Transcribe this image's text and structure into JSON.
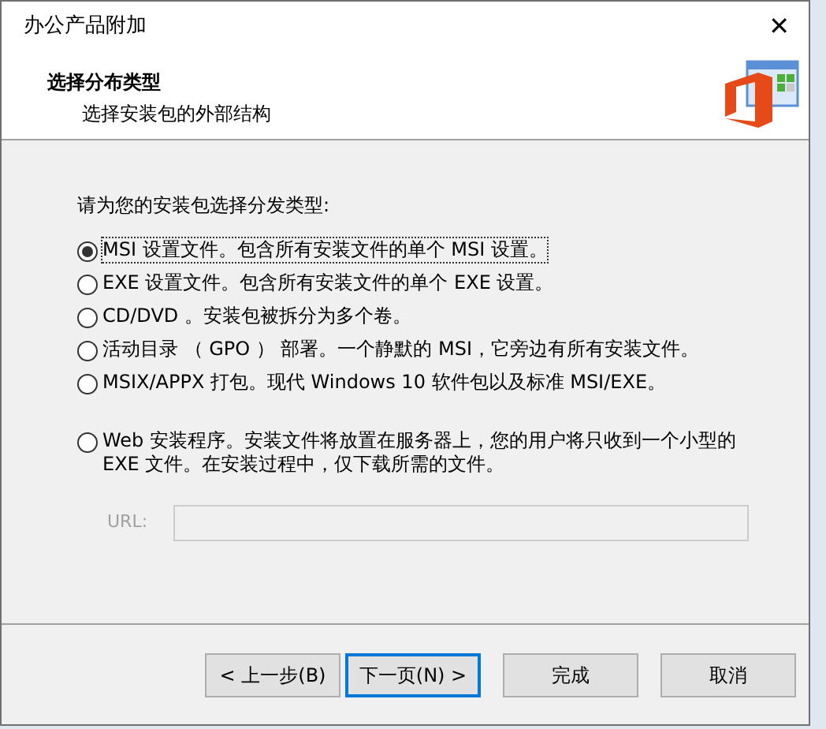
{
  "window": {
    "title": "办公产品附加",
    "close": "✕"
  },
  "header": {
    "title": "选择分布类型",
    "subtitle": "选择安装包的外部结构"
  },
  "prompt": "请为您的安装包选择分发类型:",
  "options": [
    {
      "label": "MSI 设置文件。包含所有安装文件的单个 MSI 设置。",
      "selected": true
    },
    {
      "label": "EXE 设置文件。包含所有安装文件的单个 EXE 设置。",
      "selected": false
    },
    {
      "label": "CD/DVD 。安装包被拆分为多个卷。",
      "selected": false
    },
    {
      "label": "活动目录 （ GPO ） 部署。一个静默的 MSI，它旁边有所有安装文件。",
      "selected": false
    },
    {
      "label": "MSIX/APPX 打包。现代 Windows 10 软件包以及标准 MSI/EXE。",
      "selected": false
    },
    {
      "label": "Web 安装程序。安装文件将放置在服务器上，您的用户将只收到一个小型的 EXE 文件。在安装过程中，仅下载所需的文件。",
      "selected": false
    }
  ],
  "url": {
    "label": "URL:",
    "disabled": true
  },
  "buttons": [
    {
      "label": "< 上一步(B)",
      "focused": false
    },
    {
      "label": "下一页(N) >",
      "focused": true
    },
    {
      "label": "完成",
      "focused": false
    },
    {
      "label": "取消",
      "focused": false
    }
  ]
}
